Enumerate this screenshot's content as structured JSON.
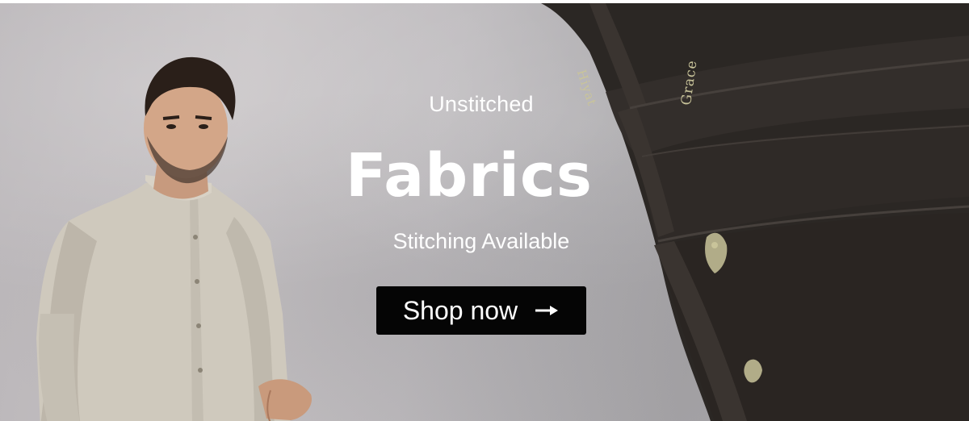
{
  "hero": {
    "eyebrow": "Unstitched",
    "headline": "Fabrics",
    "subline": "Stitching Available",
    "cta_label": "Shop now",
    "cta_icon": "arrow-right-icon"
  },
  "fabric_selvedge_text": [
    "Hiyat",
    "Grace"
  ],
  "colors": {
    "button_bg": "#050505",
    "text": "#ffffff",
    "fabric": "#2b2724",
    "selvedge_print": "#c9c49a",
    "kurta": "#cfc9bd"
  }
}
